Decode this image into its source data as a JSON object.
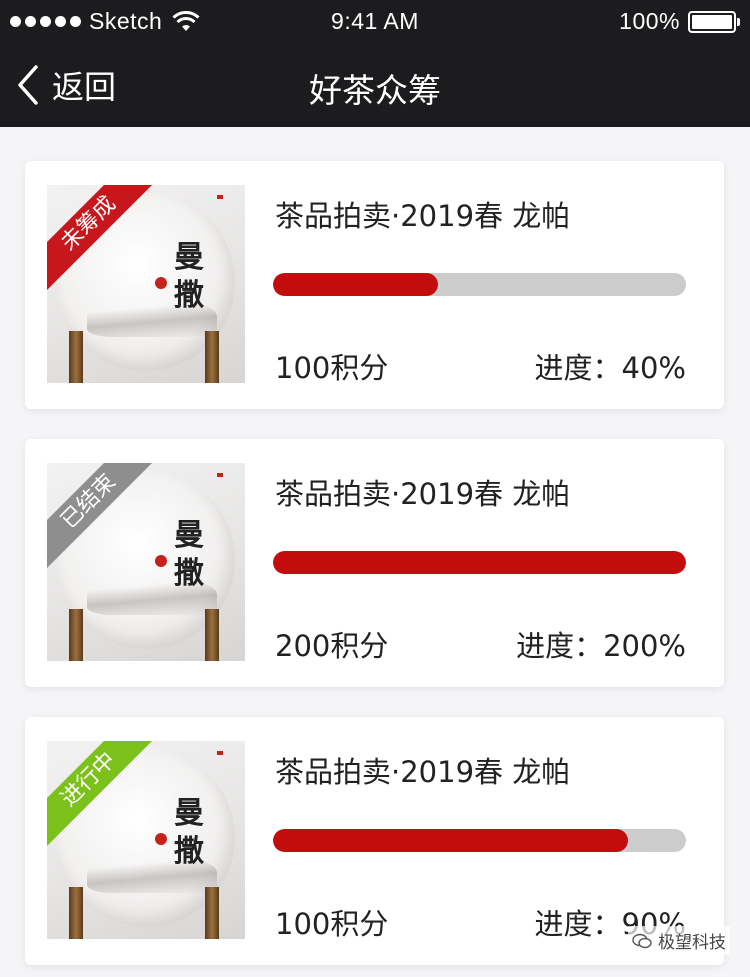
{
  "status_bar": {
    "carrier": "Sketch",
    "time": "9:41 AM",
    "battery": "100%",
    "signal_icon": "signal-dots-icon",
    "wifi_icon": "wifi-icon",
    "battery_icon": "battery-icon"
  },
  "nav": {
    "back_label": "返回",
    "title": "好茶众筹"
  },
  "items": [
    {
      "status": "未筹成",
      "status_color": "#c8161d",
      "title": "茶品拍卖·2019春 龙帕",
      "points": "100积分",
      "progress_label": "进度：40%",
      "progress": 0.4,
      "image_text": "曼撒"
    },
    {
      "status": "已结束",
      "status_color": "#8e8e8e",
      "title": "茶品拍卖·2019春 龙帕",
      "points": "200积分",
      "progress_label": "进度：200%",
      "progress": 1.0,
      "image_text": "曼撒"
    },
    {
      "status": "进行中",
      "status_color": "#7cc11b",
      "title": "茶品拍卖·2019春 龙帕",
      "points": "100积分",
      "progress_label": "进度：90%",
      "progress": 0.86,
      "image_text": "曼撒"
    }
  ],
  "colors": {
    "nav_bg": "#1c1c1e",
    "progress_fill": "#c30d0d",
    "progress_track": "#cdcccd"
  },
  "watermark": "极望科技"
}
